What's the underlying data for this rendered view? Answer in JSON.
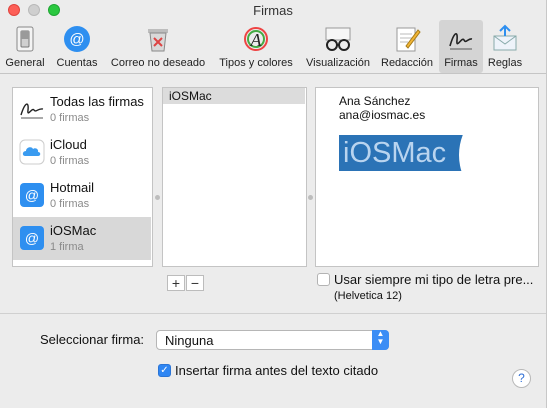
{
  "window": {
    "title": "Firmas"
  },
  "toolbar": {
    "items": [
      {
        "label": "General",
        "icon": "switch-icon"
      },
      {
        "label": "Cuentas",
        "icon": "at-sign-icon"
      },
      {
        "label": "Correo no deseado",
        "icon": "trash-junk-icon"
      },
      {
        "label": "Tipos y colores",
        "icon": "font-color-icon"
      },
      {
        "label": "Visualización",
        "icon": "glasses-icon"
      },
      {
        "label": "Redacción",
        "icon": "notepad-pencil-icon"
      },
      {
        "label": "Firmas",
        "icon": "signature-icon"
      },
      {
        "label": "Reglas",
        "icon": "rules-envelope-icon"
      }
    ],
    "selected": "Firmas"
  },
  "accounts": [
    {
      "name": "Todas las firmas",
      "count": "0 firmas",
      "icon": "signature-icon"
    },
    {
      "name": "iCloud",
      "count": "0 firmas",
      "icon": "icloud-icon"
    },
    {
      "name": "Hotmail",
      "count": "0 firmas",
      "icon": "at-sign-icon"
    },
    {
      "name": "iOSMac",
      "count": "1 firma",
      "icon": "at-sign-icon"
    }
  ],
  "signatures": {
    "items": [
      "iOSMac"
    ],
    "add_label": "+",
    "remove_label": "−"
  },
  "preview": {
    "name": "Ana Sánchez",
    "email": "ana@iosmac.es",
    "logo_text": "iOSMac",
    "logo_color": "#2b73b6"
  },
  "font_option": {
    "label": "Usar siempre mi tipo de letra pre...",
    "font": "(Helvetica 12)",
    "checked": false
  },
  "select_signature": {
    "label": "Seleccionar firma:",
    "value": "Ninguna"
  },
  "insert_option": {
    "label": "Insertar firma antes del texto citado",
    "checked": true
  },
  "help": {
    "label": "?"
  },
  "colors": {
    "accent": "#2f86f3",
    "close": "#fd5f57",
    "zoom": "#2bc840"
  }
}
